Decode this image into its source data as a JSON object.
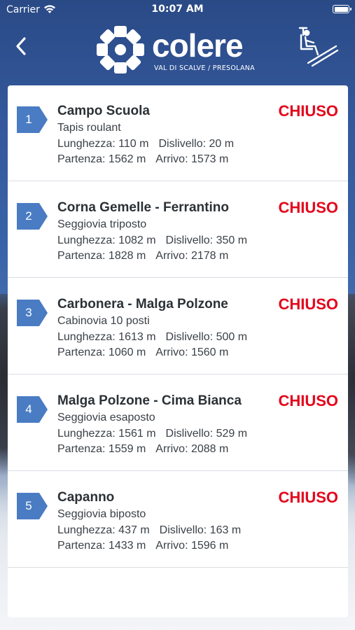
{
  "status_bar": {
    "carrier": "Carrier",
    "time": "10:07 AM"
  },
  "header": {
    "brand": "colere",
    "tagline": "VAL DI SCALVE / PRESOLANA",
    "back_icon": "chevron-left-icon",
    "action_icon": "chairlift-icon"
  },
  "colors": {
    "header_blue": "#2f4f88",
    "badge_blue": "#4a7cc4",
    "closed_red": "#e3051b",
    "text_dark": "#2b3136"
  },
  "lifts": [
    {
      "number": "1",
      "name": "Campo Scuola",
      "type": "Tapis roulant",
      "length": "Lunghezza: 110 m",
      "drop": "Dislivello: 20 m",
      "start": "Partenza: 1562 m",
      "end": "Arrivo: 1573 m",
      "status": "CHIUSO"
    },
    {
      "number": "2",
      "name": "Corna Gemelle - Ferrantino",
      "type": "Seggiovia triposto",
      "length": "Lunghezza: 1082 m",
      "drop": "Dislivello: 350 m",
      "start": "Partenza: 1828 m",
      "end": "Arrivo: 2178 m",
      "status": "CHIUSO"
    },
    {
      "number": "3",
      "name": "Carbonera - Malga Polzone",
      "type": "Cabinovia 10 posti",
      "length": "Lunghezza: 1613 m",
      "drop": "Dislivello: 500 m",
      "start": "Partenza: 1060 m",
      "end": "Arrivo: 1560 m",
      "status": "CHIUSO"
    },
    {
      "number": "4",
      "name": "Malga Polzone - Cima Bianca",
      "type": "Seggiovia esaposto",
      "length": "Lunghezza: 1561 m",
      "drop": "Dislivello: 529 m",
      "start": "Partenza: 1559 m",
      "end": "Arrivo: 2088 m",
      "status": "CHIUSO"
    },
    {
      "number": "5",
      "name": "Capanno",
      "type": "Seggiovia biposto",
      "length": "Lunghezza: 437 m",
      "drop": "Dislivello: 163 m",
      "start": "Partenza: 1433 m",
      "end": "Arrivo: 1596 m",
      "status": "CHIUSO"
    }
  ]
}
